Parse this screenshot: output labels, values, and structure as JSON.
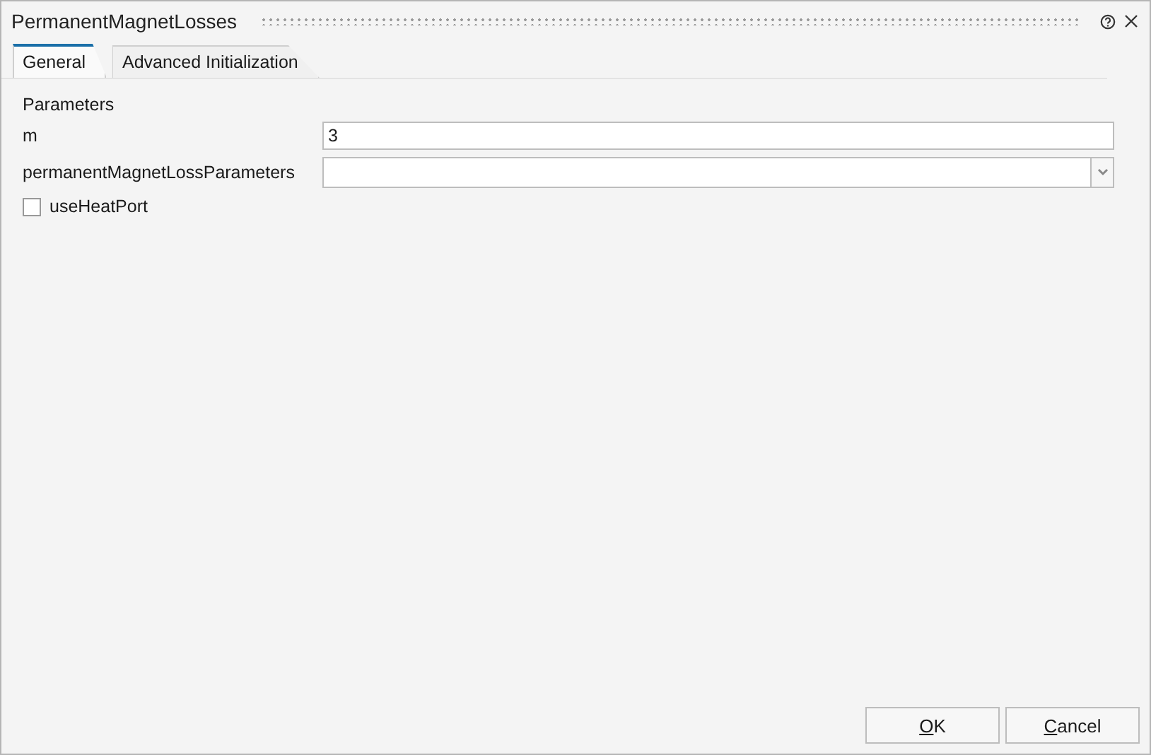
{
  "window": {
    "title": "PermanentMagnetLosses"
  },
  "tabs": [
    {
      "label": "General",
      "selected": true
    },
    {
      "label": "Advanced Initialization",
      "selected": false
    }
  ],
  "section": "Parameters",
  "fields": [
    {
      "kind": "text",
      "label": "m",
      "value": "3"
    },
    {
      "kind": "combo",
      "label": "permanentMagnetLossParameters"
    }
  ],
  "checkboxes": [
    {
      "label": "useHeatPort",
      "checked": false
    }
  ],
  "buttons": [
    {
      "label": "OK",
      "first_letter_underlined": true
    },
    {
      "label": "Cancel",
      "first_letter_underlined": true
    }
  ]
}
